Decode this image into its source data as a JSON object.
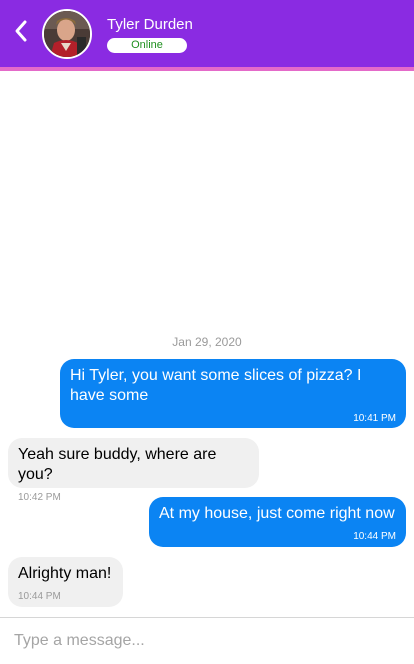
{
  "header": {
    "contact_name": "Tyler Durden",
    "status": "Online",
    "back_icon": "chevron-left-icon",
    "avatar": "contact-avatar-photo",
    "colors": {
      "header_bg": "#8a2be2",
      "stripe": "#e46ac9",
      "status_text": "#1f8f1f"
    }
  },
  "conversation": {
    "date_divider": "Jan 29, 2020",
    "messages": [
      {
        "direction": "outgoing",
        "text": "Hi Tyler, you want some slices of pizza? I have some",
        "time": "10:41 PM"
      },
      {
        "direction": "incoming",
        "text": "Yeah sure buddy, where are you?",
        "time": "10:42 PM"
      },
      {
        "direction": "outgoing",
        "text": "At my house, just come right now",
        "time": "10:44 PM"
      },
      {
        "direction": "incoming",
        "text": "Alrighty man!",
        "time": "10:44 PM"
      }
    ],
    "colors": {
      "outgoing_bubble": "#0b84f3",
      "incoming_bubble": "#f0f0f0"
    }
  },
  "composer": {
    "placeholder": "Type a message...",
    "value": ""
  }
}
